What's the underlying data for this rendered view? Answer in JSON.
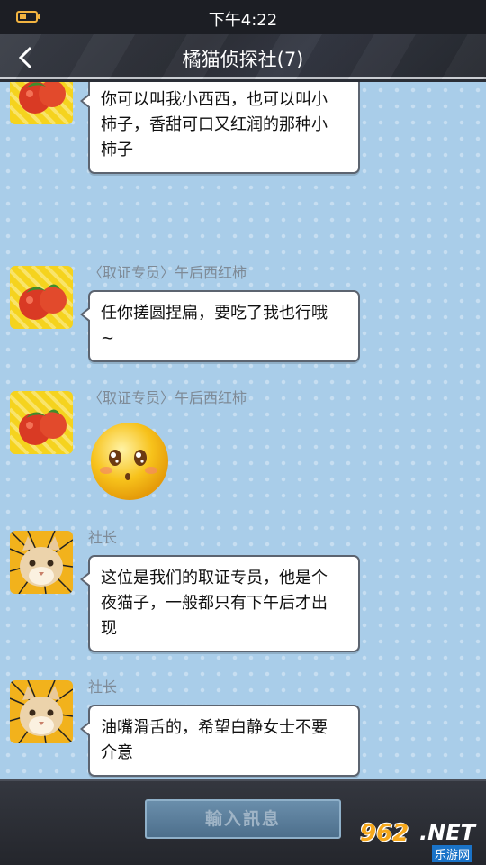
{
  "status_bar": {
    "time": "下午4:22",
    "battery_icon": "battery-icon",
    "battery_level_percent": 45
  },
  "header": {
    "title": "橘猫侦探社(7)",
    "back_icon": "back-arrow-icon"
  },
  "messages": [
    {
      "sender": "",
      "avatar": "tomato-avatar",
      "lines": [
        "你可以叫我小西西，也可以叫小",
        "柿子，香甜可口又红润的那种小",
        "柿子"
      ]
    },
    {
      "sender": "〈取证专员〉午后西红柿",
      "avatar": "tomato-avatar",
      "lines": [
        "任你搓圆捏扁，要吃了我也行哦",
        "~"
      ]
    },
    {
      "sender": "〈取证专员〉午后西红柿",
      "avatar": "tomato-avatar",
      "sticker": "surprised-emoji-sticker"
    },
    {
      "sender": "社长",
      "avatar": "cat-avatar",
      "lines": [
        "这位是我们的取证专员，他是个",
        "夜猫子，一般都只有下午后才出",
        "现"
      ]
    },
    {
      "sender": "社长",
      "avatar": "cat-avatar",
      "lines": [
        "油嘴滑舌的，希望白静女士不要",
        "介意"
      ]
    }
  ],
  "footer": {
    "input_button_label": "輸入訊息"
  },
  "watermark": {
    "brand": "962",
    "suffix": ".NET",
    "sub": "乐游网"
  },
  "colors": {
    "chat_bg": "#a9cde9",
    "bubble_border": "#5c6470",
    "battery": "#f2b441"
  }
}
